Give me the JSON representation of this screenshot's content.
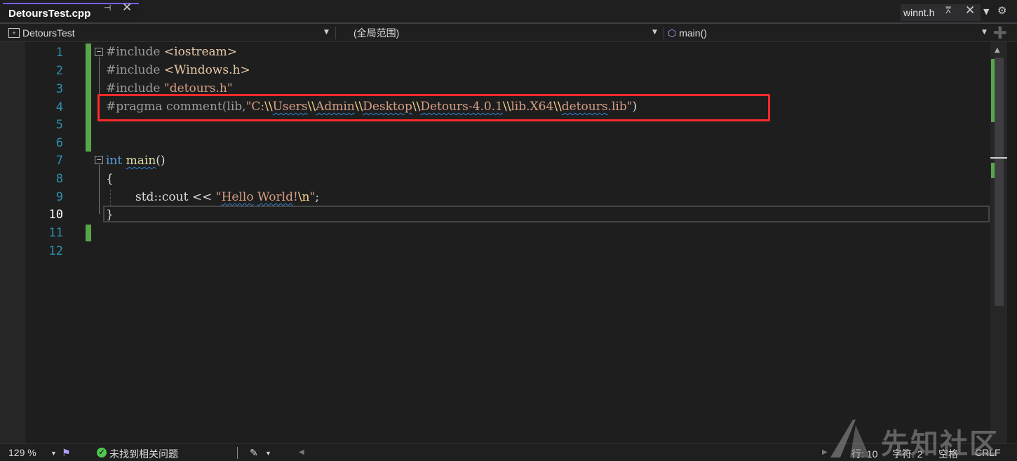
{
  "tabs": {
    "active": {
      "title": "DetoursTest.cpp",
      "pin_icon": "pin-icon",
      "close_icon": "close-icon"
    },
    "secondary": {
      "title": "winnt.h",
      "pin_icon": "pin-icon",
      "close_icon": "close-icon"
    },
    "overflow_icon": "chevron-down-icon",
    "settings_icon": "gear-icon"
  },
  "navbar": {
    "project": "DetoursTest",
    "scope": "(全局范围)",
    "member": "main()",
    "split_icon": "split-icon"
  },
  "editor": {
    "line_numbers": [
      "1",
      "2",
      "3",
      "4",
      "5",
      "6",
      "7",
      "8",
      "9",
      "10",
      "11",
      "12"
    ],
    "current_line": "10",
    "lines": {
      "l1_pp": "#include",
      "l1_inc": "<iostream>",
      "l2_pp": "#include",
      "l2_inc": "<Windows.h>",
      "l3_pp": "#include",
      "l3_str": "\"detours.h\"",
      "l4_pp": "#pragma",
      "l4_comment": "comment(lib,",
      "l4_s1": "\"C:",
      "l4_e1": "\\\\",
      "l4_s2": "Users",
      "l4_e2": "\\\\",
      "l4_s3": "Admin",
      "l4_e3": "\\\\",
      "l4_s4": "Desktop",
      "l4_e4": "\\\\",
      "l4_s5": "Detours-4.0.1",
      "l4_e5": "\\\\",
      "l4_s6": "lib.X64",
      "l4_e6": "\\\\",
      "l4_s7": "detours",
      "l4_s8": ".lib\"",
      "l4_close": ")",
      "l7_kw": "int",
      "l7_fn": "main",
      "l7_rest": "()",
      "l8": "{",
      "l9_a": "std::cout <<",
      "l9_str_open": "\"",
      "l9_hello": "Hello",
      "l9_sp": " ",
      "l9_world": "World",
      "l9_bang": "!",
      "l9_esc": "\\n",
      "l9_str_close": "\"",
      "l9_semi": ";",
      "l10": "}"
    }
  },
  "status": {
    "zoom": "129 %",
    "issues": "未找到相关问题",
    "line": "行: 10",
    "char": "字符: 2",
    "whitespace": "空格",
    "eol": "CRLF"
  },
  "watermark": "先知社区",
  "colors": {
    "accent": "#7160e8",
    "change_bar": "#57a64a",
    "highlight_box": "#ff2a2a",
    "keyword": "#569cd6",
    "string": "#d69d85",
    "line_number": "#2b91af"
  }
}
